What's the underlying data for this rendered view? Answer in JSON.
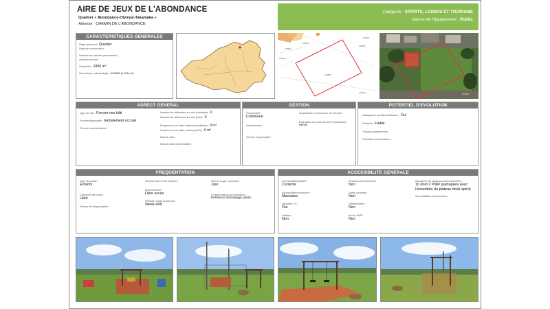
{
  "header": {
    "title": "AIRE DE JEUX DE L'ABONDANCE",
    "subtitle": "Quartier « Abondance-Olympe-Takamaka »",
    "address_label": "Adresse :",
    "address_value": "CHEMIN DE L'ABONDANCE"
  },
  "category": {
    "category_label": "Catégorie :",
    "category_value": "SPORTS, LOISIRS ET TOURISME",
    "nature_label": "Nature de l'équipement :",
    "nature_value": "Public"
  },
  "caracteristiques": {
    "heading": "CARACTERISTIQUES GENERALES",
    "rows": [
      {
        "label": "Regroupement :",
        "value": "Quartier"
      },
      {
        "label": "Date de construction :",
        "value": ""
      },
      {
        "label": "Nombre de salariés permanents :",
        "value": ""
      },
      {
        "label": "Gardien sur site :",
        "value": ""
      },
      {
        "label": "Superficie :",
        "value": "1950 m²"
      },
      {
        "label": "Parcelle(s) cadastrale(s) :",
        "value": "AX0638 (1 950 m²)"
      }
    ]
  },
  "aspect": {
    "heading": "ASPECT GENERAL",
    "type_site_label": "Type de site :",
    "type_site_value": "Foncier non bâti",
    "foncier_label": "Foncier disponible :",
    "foncier_value": "Globalement occupé",
    "foncier_comm_label": "Foncier commentaires :",
    "bat_cadastre_label": "Nombre de bâtiments sur site (cadastre) :",
    "bat_cadastre_value": "0",
    "bat_ign_label": "Nombre de bâtiments sur site (IGN) :",
    "bat_ign_value": "0",
    "emprise_cadastre_label": "Emprise au sol bâtie estimée (cadastre) :",
    "emprise_cadastre_value": "0 m²",
    "emprise_ign_label": "Emprise au sol bâtie estimée (IGN) :",
    "emprise_ign_value": "0 m²",
    "etat_bati_label": "Etat du bâti :",
    "etat_comm_label": "Etat du bâti commentaires :"
  },
  "gestion": {
    "heading": "GESTION",
    "proprietaire_label": "Propriétaire :",
    "proprietaire_value": "Commune",
    "gestionnaire_label": "Gestionnaire :",
    "service_label": "Service responsable :",
    "autorisation_label": "Autorisation commission de sécurité :",
    "cout_label": "Estimation du coût annuel d'exploitation :",
    "cout_value": "euros"
  },
  "potentiel": {
    "heading": "POTENTIEL D'EVOLUTION",
    "adequation_label": "Adéquation vocation/utilisation :",
    "adequation_value": "Oui",
    "potentiel_label": "Potentiel :",
    "potentiel_value": "Faible",
    "travaux_label": "Travaux programmés :",
    "comm_label": "Potentiel commentaires :"
  },
  "frequentation": {
    "heading": "FREQUENTATION",
    "type_public_label": "Type de public :",
    "type_public_value": "Enfants",
    "categorie_label": "Catégorie de public :",
    "categorie_value": "Libre",
    "niveau_label": "Niveau de fréquentation :",
    "nb_visiteurs_label": "Nombre annuel de visiteurs :",
    "droit_label": "Droit d'entrée :",
    "droit_value": "Libre accès",
    "periode_label": "Période usage maximum :",
    "periode_value": "Week-end",
    "heure_label": "Heure usage maximum :",
    "heure_value": "Jour",
    "prefer_label": "Fréquentation commentaires :",
    "prefer_value": "Présence d'éclairage public."
  },
  "accessibilite": {
    "heading": "ACCESSIBILITE GENERALE",
    "quartier_label": "Accessibilité/quartier :",
    "quartier_value": "Correcte",
    "commune_label": "Accessibilité/commune :",
    "commune_value": "Mauvaise",
    "desserte_label": "Desserte TC :",
    "desserte_value": "Oui",
    "abribus_label": "Abribus :",
    "abribus_value": "Non",
    "trottoirs_label": "Trottoirs/cheminements :",
    "trottoirs_value": "Non",
    "voies_label": "Voies cyclables :",
    "voies_value": "Non",
    "jalonnement_label": "Jalonnement :",
    "jalonnement_value": "Non",
    "pmr_label": "Accès PMR :",
    "pmr_value": "Non",
    "stationnement_label": "Nb places de stationnements affectées :",
    "stationnement_value": "10 dont 2 PMR (partagées avec l'ensemble du plateau multi-sport)",
    "comm_label": "Accessibilité commentaires :"
  },
  "map_labels": {
    "plan_labels": [
      "AX0602",
      "AX0603",
      "AX0629",
      "AX0638",
      "AX0604",
      "AX0605"
    ],
    "scale_left": "0 10 20 m",
    "scale_right": "0 10 20 m"
  },
  "colors": {
    "category_green": "#8bbd53",
    "section_grey": "#7a7a7a",
    "district_fill": "#f6d79a",
    "parcel_red": "#e03030"
  }
}
